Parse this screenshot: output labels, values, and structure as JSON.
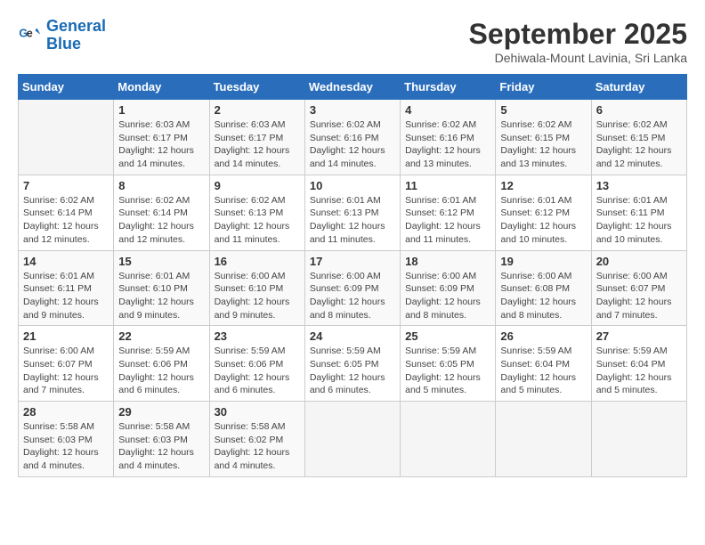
{
  "header": {
    "logo_line1": "General",
    "logo_line2": "Blue",
    "month": "September 2025",
    "location": "Dehiwala-Mount Lavinia, Sri Lanka"
  },
  "weekdays": [
    "Sunday",
    "Monday",
    "Tuesday",
    "Wednesday",
    "Thursday",
    "Friday",
    "Saturday"
  ],
  "weeks": [
    [
      {
        "day": "",
        "info": ""
      },
      {
        "day": "1",
        "info": "Sunrise: 6:03 AM\nSunset: 6:17 PM\nDaylight: 12 hours\nand 14 minutes."
      },
      {
        "day": "2",
        "info": "Sunrise: 6:03 AM\nSunset: 6:17 PM\nDaylight: 12 hours\nand 14 minutes."
      },
      {
        "day": "3",
        "info": "Sunrise: 6:02 AM\nSunset: 6:16 PM\nDaylight: 12 hours\nand 14 minutes."
      },
      {
        "day": "4",
        "info": "Sunrise: 6:02 AM\nSunset: 6:16 PM\nDaylight: 12 hours\nand 13 minutes."
      },
      {
        "day": "5",
        "info": "Sunrise: 6:02 AM\nSunset: 6:15 PM\nDaylight: 12 hours\nand 13 minutes."
      },
      {
        "day": "6",
        "info": "Sunrise: 6:02 AM\nSunset: 6:15 PM\nDaylight: 12 hours\nand 12 minutes."
      }
    ],
    [
      {
        "day": "7",
        "info": "Sunrise: 6:02 AM\nSunset: 6:14 PM\nDaylight: 12 hours\nand 12 minutes."
      },
      {
        "day": "8",
        "info": "Sunrise: 6:02 AM\nSunset: 6:14 PM\nDaylight: 12 hours\nand 12 minutes."
      },
      {
        "day": "9",
        "info": "Sunrise: 6:02 AM\nSunset: 6:13 PM\nDaylight: 12 hours\nand 11 minutes."
      },
      {
        "day": "10",
        "info": "Sunrise: 6:01 AM\nSunset: 6:13 PM\nDaylight: 12 hours\nand 11 minutes."
      },
      {
        "day": "11",
        "info": "Sunrise: 6:01 AM\nSunset: 6:12 PM\nDaylight: 12 hours\nand 11 minutes."
      },
      {
        "day": "12",
        "info": "Sunrise: 6:01 AM\nSunset: 6:12 PM\nDaylight: 12 hours\nand 10 minutes."
      },
      {
        "day": "13",
        "info": "Sunrise: 6:01 AM\nSunset: 6:11 PM\nDaylight: 12 hours\nand 10 minutes."
      }
    ],
    [
      {
        "day": "14",
        "info": "Sunrise: 6:01 AM\nSunset: 6:11 PM\nDaylight: 12 hours\nand 9 minutes."
      },
      {
        "day": "15",
        "info": "Sunrise: 6:01 AM\nSunset: 6:10 PM\nDaylight: 12 hours\nand 9 minutes."
      },
      {
        "day": "16",
        "info": "Sunrise: 6:00 AM\nSunset: 6:10 PM\nDaylight: 12 hours\nand 9 minutes."
      },
      {
        "day": "17",
        "info": "Sunrise: 6:00 AM\nSunset: 6:09 PM\nDaylight: 12 hours\nand 8 minutes."
      },
      {
        "day": "18",
        "info": "Sunrise: 6:00 AM\nSunset: 6:09 PM\nDaylight: 12 hours\nand 8 minutes."
      },
      {
        "day": "19",
        "info": "Sunrise: 6:00 AM\nSunset: 6:08 PM\nDaylight: 12 hours\nand 8 minutes."
      },
      {
        "day": "20",
        "info": "Sunrise: 6:00 AM\nSunset: 6:07 PM\nDaylight: 12 hours\nand 7 minutes."
      }
    ],
    [
      {
        "day": "21",
        "info": "Sunrise: 6:00 AM\nSunset: 6:07 PM\nDaylight: 12 hours\nand 7 minutes."
      },
      {
        "day": "22",
        "info": "Sunrise: 5:59 AM\nSunset: 6:06 PM\nDaylight: 12 hours\nand 6 minutes."
      },
      {
        "day": "23",
        "info": "Sunrise: 5:59 AM\nSunset: 6:06 PM\nDaylight: 12 hours\nand 6 minutes."
      },
      {
        "day": "24",
        "info": "Sunrise: 5:59 AM\nSunset: 6:05 PM\nDaylight: 12 hours\nand 6 minutes."
      },
      {
        "day": "25",
        "info": "Sunrise: 5:59 AM\nSunset: 6:05 PM\nDaylight: 12 hours\nand 5 minutes."
      },
      {
        "day": "26",
        "info": "Sunrise: 5:59 AM\nSunset: 6:04 PM\nDaylight: 12 hours\nand 5 minutes."
      },
      {
        "day": "27",
        "info": "Sunrise: 5:59 AM\nSunset: 6:04 PM\nDaylight: 12 hours\nand 5 minutes."
      }
    ],
    [
      {
        "day": "28",
        "info": "Sunrise: 5:58 AM\nSunset: 6:03 PM\nDaylight: 12 hours\nand 4 minutes."
      },
      {
        "day": "29",
        "info": "Sunrise: 5:58 AM\nSunset: 6:03 PM\nDaylight: 12 hours\nand 4 minutes."
      },
      {
        "day": "30",
        "info": "Sunrise: 5:58 AM\nSunset: 6:02 PM\nDaylight: 12 hours\nand 4 minutes."
      },
      {
        "day": "",
        "info": ""
      },
      {
        "day": "",
        "info": ""
      },
      {
        "day": "",
        "info": ""
      },
      {
        "day": "",
        "info": ""
      }
    ]
  ]
}
